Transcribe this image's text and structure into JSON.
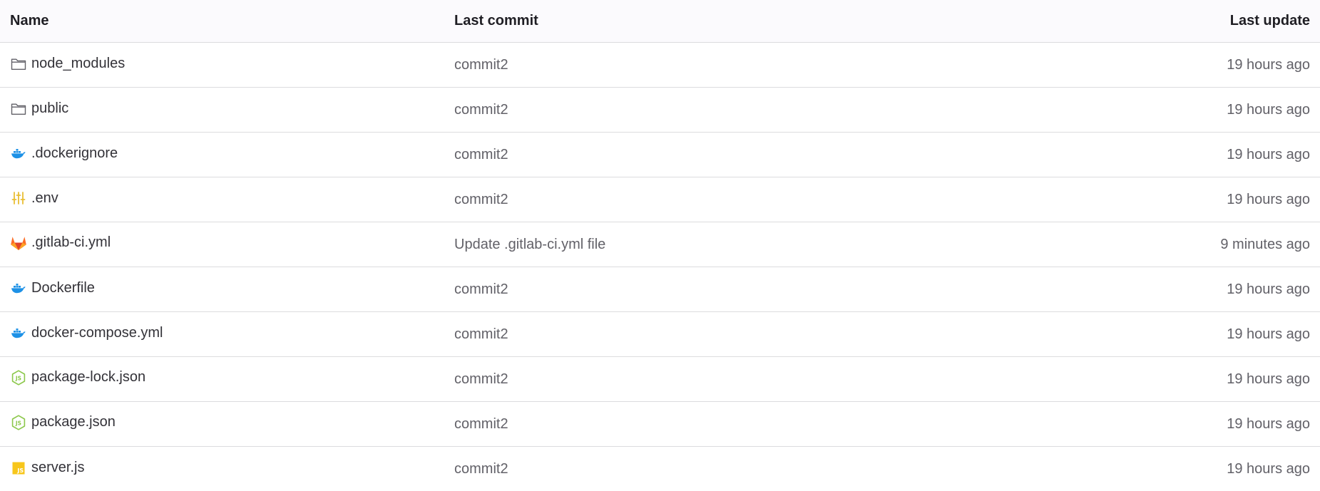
{
  "table": {
    "headers": {
      "name": "Name",
      "last_commit": "Last commit",
      "last_update": "Last update"
    },
    "rows": [
      {
        "name": "node_modules",
        "icon": "folder-icon",
        "commit": "commit2",
        "updated": "19 hours ago"
      },
      {
        "name": "public",
        "icon": "folder-icon",
        "commit": "commit2",
        "updated": "19 hours ago"
      },
      {
        "name": ".dockerignore",
        "icon": "docker-icon",
        "commit": "commit2",
        "updated": "19 hours ago"
      },
      {
        "name": ".env",
        "icon": "settings-sliders-icon",
        "commit": "commit2",
        "updated": "19 hours ago"
      },
      {
        "name": ".gitlab-ci.yml",
        "icon": "gitlab-icon",
        "commit": "Update .gitlab-ci.yml file",
        "updated": "9 minutes ago"
      },
      {
        "name": "Dockerfile",
        "icon": "docker-icon",
        "commit": "commit2",
        "updated": "19 hours ago"
      },
      {
        "name": "docker-compose.yml",
        "icon": "docker-icon",
        "commit": "commit2",
        "updated": "19 hours ago"
      },
      {
        "name": "package-lock.json",
        "icon": "nodejs-icon",
        "commit": "commit2",
        "updated": "19 hours ago"
      },
      {
        "name": "package.json",
        "icon": "nodejs-icon",
        "commit": "commit2",
        "updated": "19 hours ago"
      },
      {
        "name": "server.js",
        "icon": "javascript-icon",
        "commit": "commit2",
        "updated": "19 hours ago"
      }
    ]
  },
  "colors": {
    "header_bg": "#fbfafd",
    "border": "#dcdcde",
    "text": "#333238",
    "muted_text": "#626168",
    "folder": "#626168",
    "docker": "#1d91e6",
    "env": "#e9be33",
    "gitlab_orange": "#e24329",
    "gitlab_light": "#fc6d26",
    "nodejs": "#8cc84b",
    "javascript": "#f7c61b"
  }
}
